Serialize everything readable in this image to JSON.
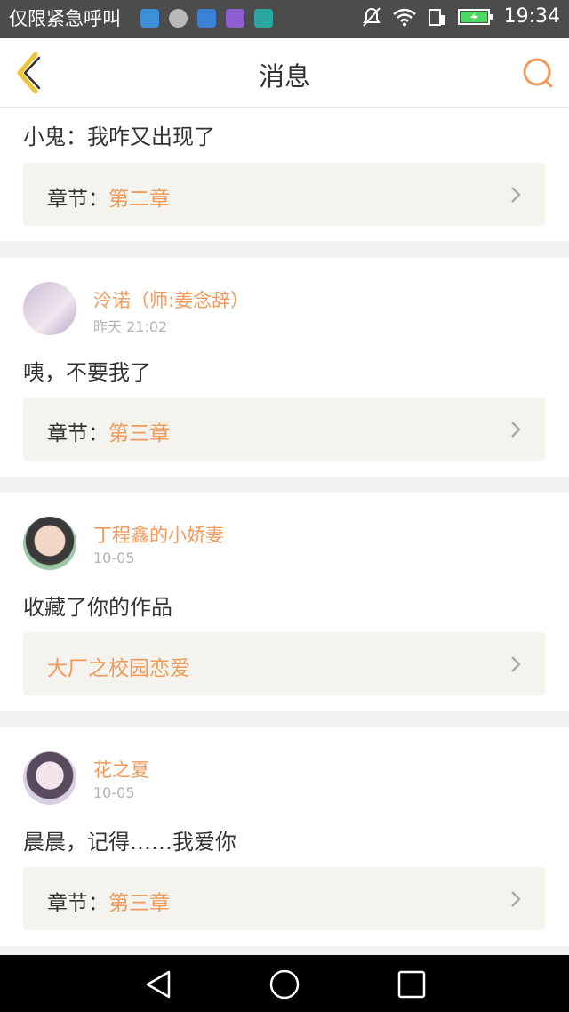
{
  "status_bar": {
    "carrier_text": "仅限紧急呼叫",
    "time": "19:34",
    "app_icon_colors": [
      "#3d8fd8",
      "#b8b8b8",
      "#3b82d6",
      "#8e5fd0",
      "#2ba6a0"
    ]
  },
  "header": {
    "title": "消息",
    "accent_color": "#f19a5a"
  },
  "messages": [
    {
      "message": "小鬼：我咋又出现了",
      "ref_label": "章节：",
      "ref_value": "第二章"
    },
    {
      "username": "泠诺（师:姜念辞）",
      "time": "昨天 21:02",
      "message": "咦，不要我了",
      "ref_label": "章节：",
      "ref_value": "第三章"
    },
    {
      "username": "丁程鑫的小娇妻",
      "time": "10-05",
      "message": "收藏了你的作品",
      "ref_label": "",
      "ref_value": "大厂之校园恋爱"
    },
    {
      "username": "花之夏",
      "time": "10-05",
      "message": "晨晨，记得……我爱你",
      "ref_label": "章节：",
      "ref_value": "第三章"
    }
  ]
}
